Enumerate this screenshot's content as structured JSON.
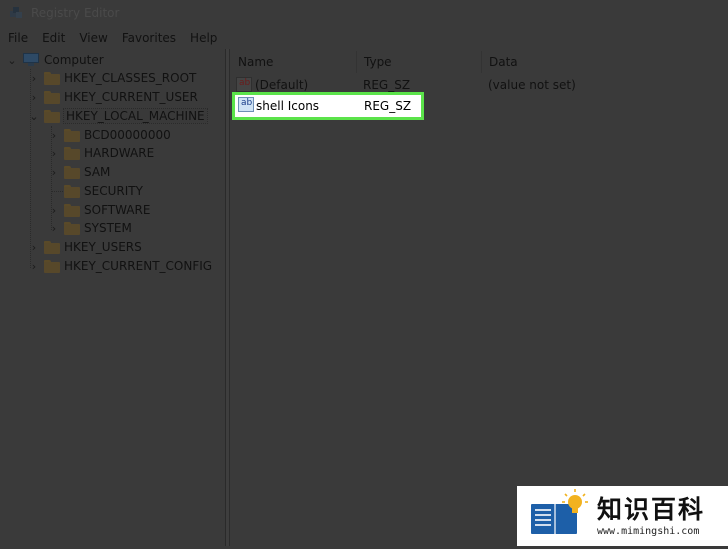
{
  "window": {
    "title": "Registry Editor"
  },
  "menu": {
    "items": [
      "File",
      "Edit",
      "View",
      "Favorites",
      "Help"
    ]
  },
  "tree": {
    "root": "Computer",
    "hives": [
      "HKEY_CLASSES_ROOT",
      "HKEY_CURRENT_USER",
      "HKEY_LOCAL_MACHINE",
      "HKEY_USERS",
      "HKEY_CURRENT_CONFIG"
    ],
    "hklm_children": [
      "BCD00000000",
      "HARDWARE",
      "SAM",
      "SECURITY",
      "SOFTWARE",
      "SYSTEM"
    ]
  },
  "list": {
    "columns": {
      "name": "Name",
      "type": "Type",
      "data": "Data"
    },
    "rows": [
      {
        "name": "(Default)",
        "type": "REG_SZ",
        "data": "(value not set)"
      },
      {
        "name": "shell Icons",
        "type": "REG_SZ",
        "data": ""
      }
    ]
  },
  "icons": {
    "value_string": "ab",
    "app": "registry-cube-icon"
  },
  "watermark": {
    "brand": "知识百科",
    "url": "www.mimingshi.com"
  },
  "colors": {
    "highlight_border": "#5be34a",
    "background": "#3a3a3a"
  }
}
